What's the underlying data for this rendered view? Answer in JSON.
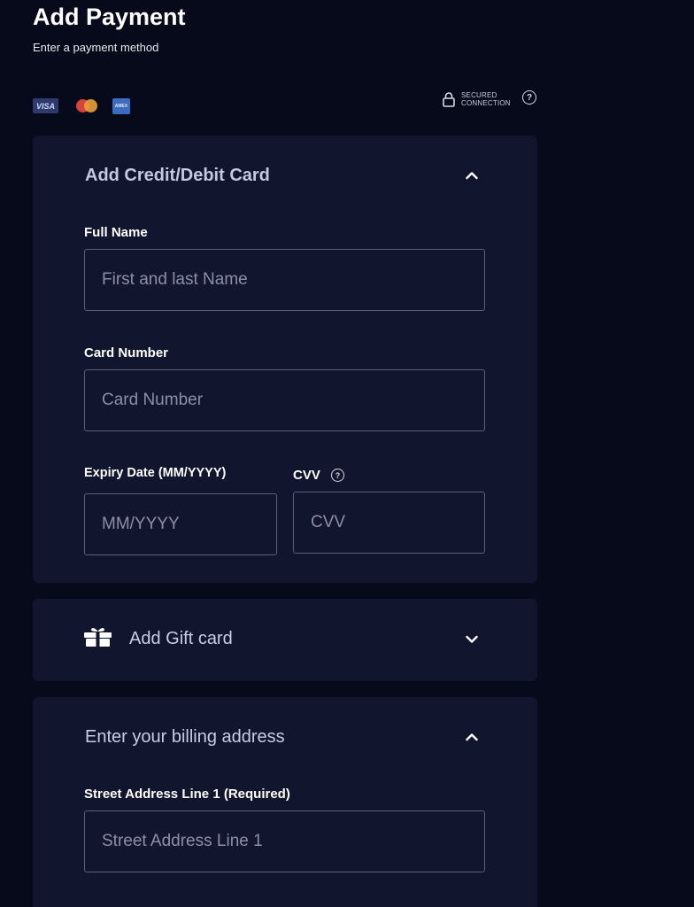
{
  "header": {
    "title": "Add Payment",
    "subtitle": "Enter a payment method"
  },
  "brands": {
    "visa": "VISA",
    "amex": "AMEX"
  },
  "security": {
    "line1": "SECURED",
    "line2": "CONNECTION",
    "help_icon": "?"
  },
  "credit_card_section": {
    "title": "Add Credit/Debit Card",
    "expanded": true,
    "full_name": {
      "label": "Full Name",
      "placeholder": "First and last Name",
      "value": ""
    },
    "card_number": {
      "label": "Card Number",
      "placeholder": "Card Number",
      "value": ""
    },
    "expiry": {
      "label": "Expiry Date (MM/YYYY)",
      "placeholder": "MM/YYYY",
      "value": ""
    },
    "cvv": {
      "label": "CVV",
      "placeholder": "CVV",
      "value": "",
      "help_icon": "?"
    }
  },
  "gift_card_section": {
    "title": "Add Gift card",
    "expanded": false
  },
  "billing_section": {
    "title": "Enter your billing address",
    "expanded": true,
    "street_line_1": {
      "label": "Street Address Line 1 (Required)",
      "placeholder": "Street Address Line 1",
      "value": ""
    }
  },
  "colors": {
    "background": "#070a1a",
    "panel": "#11152e",
    "input_border": "#5b5f78",
    "placeholder": "#8c8fa5"
  }
}
